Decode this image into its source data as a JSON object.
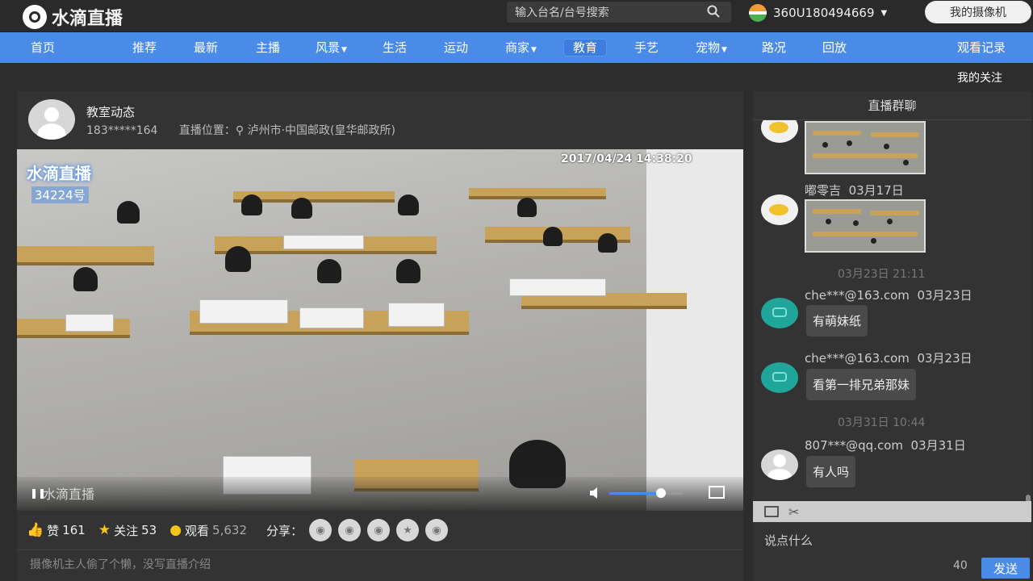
{
  "brand": {
    "name": "水滴直播"
  },
  "search": {
    "placeholder": "输入台名/台号搜索"
  },
  "user": {
    "name": "360U180494669",
    "camera_button": "我的摄像机"
  },
  "nav": {
    "items": [
      {
        "label": "首页",
        "dropdown": false
      },
      {
        "label": "推荐",
        "dropdown": false
      },
      {
        "label": "最新",
        "dropdown": false
      },
      {
        "label": "主播",
        "dropdown": false
      },
      {
        "label": "风景",
        "dropdown": true
      },
      {
        "label": "生活",
        "dropdown": false
      },
      {
        "label": "运动",
        "dropdown": false
      },
      {
        "label": "商家",
        "dropdown": true
      },
      {
        "label": "教育",
        "dropdown": false,
        "active": true
      },
      {
        "label": "手艺",
        "dropdown": false
      },
      {
        "label": "宠物",
        "dropdown": true
      },
      {
        "label": "路况",
        "dropdown": false
      },
      {
        "label": "回放",
        "dropdown": false
      }
    ],
    "history": "观看记录",
    "my_follow": "我的关注",
    "accent": "#4a8be8"
  },
  "room": {
    "title": "教室动态",
    "owner_id": "183*****164",
    "location": "直播位置：⚲ 泸州市·中国邮政(皇华邮政所)",
    "timestamp": "2017/04/24 14:38:20",
    "watermark": "水滴直播",
    "watermark_count": "34224号",
    "volume": 0.7,
    "likes_label": "赞",
    "likes": "161",
    "follow_label": "关注",
    "follows": "53",
    "views_label": "观看",
    "views": "5,632",
    "share_label": "分享：",
    "intro": "摄像机主人偷了个懒，没写直播介绍"
  },
  "chat": {
    "title": "直播群聊",
    "messages": [
      {
        "avatar": "yellow",
        "name": "",
        "date": "",
        "image": true
      },
      {
        "avatar": "yellow",
        "name": "嘟零吉",
        "date": "03月17日",
        "image": true
      },
      {
        "separator": "03月23日 21:11"
      },
      {
        "avatar": "teal",
        "name": "che***@163.com",
        "date": "03月23日",
        "text": "有萌妹纸"
      },
      {
        "avatar": "teal",
        "name": "che***@163.com",
        "date": "03月23日",
        "text": "看第一排兄弟那妹"
      },
      {
        "separator": "03月31日 10:44"
      },
      {
        "avatar": "grey",
        "name": "807***@qq.com",
        "date": "03月31日",
        "text": "有人吗"
      }
    ],
    "input_placeholder": "说点什么",
    "char_count": "40",
    "send_label": "发送"
  }
}
